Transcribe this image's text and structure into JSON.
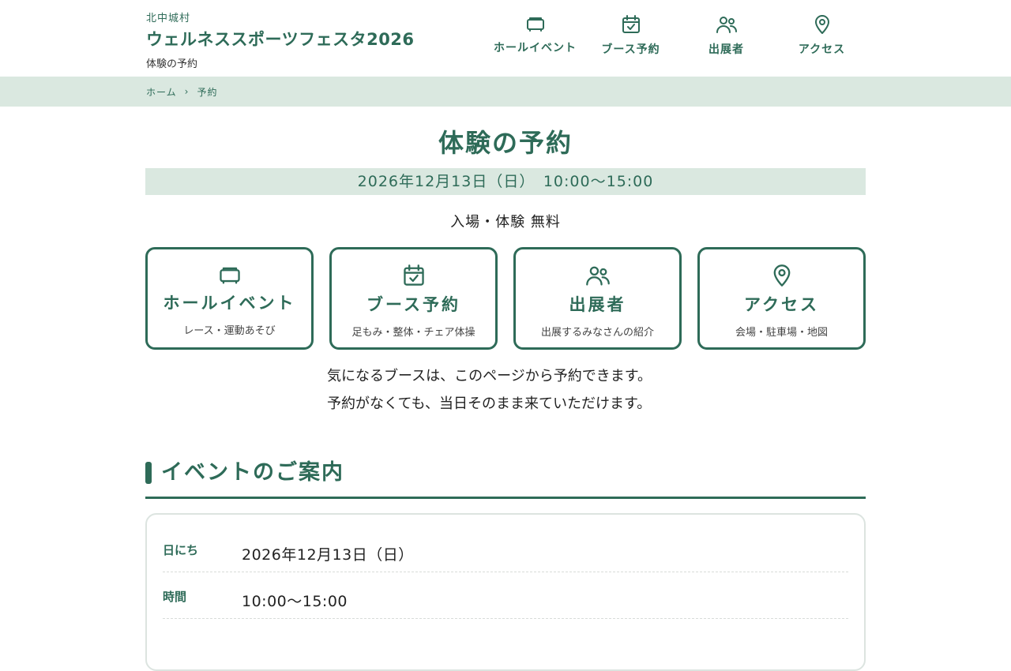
{
  "header": {
    "village": "北中城村",
    "title": "ウェルネススポーツフェスタ2026",
    "subtitle": "体験の予約",
    "nav": [
      {
        "label": "ホールイベント",
        "icon": "hall-icon"
      },
      {
        "label": "ブース予約",
        "icon": "calendar-check-icon"
      },
      {
        "label": "出展者",
        "icon": "people-icon"
      },
      {
        "label": "アクセス",
        "icon": "map-pin-icon"
      }
    ]
  },
  "breadcrumb": {
    "home": "ホーム",
    "separator": "›",
    "current": "予約"
  },
  "main": {
    "title": "体験の予約",
    "date_band": "2026年12月13日（日）　10:00〜15:00",
    "free_text": "入場・体験 無料",
    "cards": [
      {
        "title": "ホールイベント",
        "desc": "レース・運動あそび",
        "icon": "hall-icon"
      },
      {
        "title": "ブース予約",
        "desc": "足もみ・整体・チェア体操",
        "icon": "calendar-check-icon"
      },
      {
        "title": "出展者",
        "desc": "出展するみなさんの紹介",
        "icon": "people-icon"
      },
      {
        "title": "アクセス",
        "desc": "会場・駐車場・地図",
        "icon": "map-pin-icon"
      }
    ],
    "intro_lines": [
      "気になるブースは、このページから予約できます。",
      "予約がなくても、当日そのまま来ていただけます。"
    ],
    "section_title": "イベントのご案内",
    "info": [
      {
        "key": "日にち",
        "value": "2026年12月13日（日）"
      },
      {
        "key": "時間",
        "value": "10:00〜15:00"
      }
    ]
  },
  "colors": {
    "accent": "#2e6b58",
    "band": "#dae8e0",
    "border_light": "#dce4e0"
  }
}
